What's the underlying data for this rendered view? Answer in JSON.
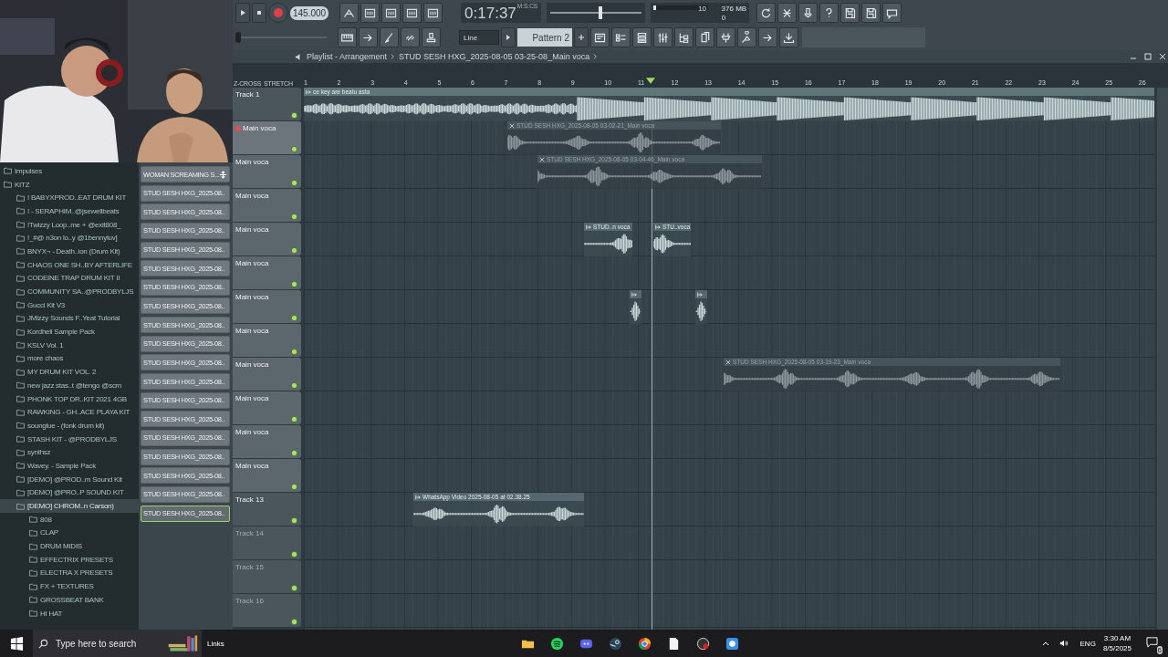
{
  "transport": {
    "recording": true,
    "tempo": "145.000",
    "time": "0:17:37",
    "time_format": "M:S:CS"
  },
  "master_volume": {
    "level": 0.55
  },
  "performance": {
    "cpu_reading": "10",
    "memory_reading": "376 MB",
    "voices_reading": "0",
    "level": 0.05
  },
  "position_slider": {
    "level": 0
  },
  "snap": "Line",
  "pattern": "Pattern 2",
  "browser": {
    "items": [
      {
        "name": "Impulses",
        "selected": false
      },
      {
        "name": "KITZ",
        "selected": false,
        "children": [
          {
            "name": "! BABYXPROD..EAT DRUM KIT",
            "selected": false
          },
          {
            "name": "! - SERAPHIM..@jsewellbeats",
            "selected": false
          },
          {
            "name": "!Twizzy Loop..me + @exit808_",
            "selected": false
          },
          {
            "name": "!_#@ n3on lo..y @1bennyluv]",
            "selected": false
          },
          {
            "name": "BNYX¬ - Death..ion (Drum Kit)",
            "selected": false
          },
          {
            "name": "CHAOS ONE SH..BY AFTERLIFE",
            "selected": false
          },
          {
            "name": "CODEINE TRAP DRUM KIT II",
            "selected": false
          },
          {
            "name": "COMMUNITY SA..@PRODBYLJS",
            "selected": false
          },
          {
            "name": "Gucci Kit V3",
            "selected": false
          },
          {
            "name": "JMizzy Sounds F..Yeat Tutorial",
            "selected": false
          },
          {
            "name": "Kordhell Sample Pack",
            "selected": false
          },
          {
            "name": "KSLV Vol. 1",
            "selected": false
          },
          {
            "name": "more chaos",
            "selected": false
          },
          {
            "name": "MY DRUM KIT VOL. 2",
            "selected": false
          },
          {
            "name": "new jazz stas..t @tengo @scrn",
            "selected": false
          },
          {
            "name": "PHONK TOP DR..KIT 2021 4GB",
            "selected": false
          },
          {
            "name": "RAWKING - GH..ACE PLAYA KIT",
            "selected": false
          },
          {
            "name": "sounglue - (fonk drum kit)",
            "selected": false
          },
          {
            "name": "STASH KIT - @PRODBYLJS",
            "selected": false
          },
          {
            "name": "synthsz",
            "selected": false
          },
          {
            "name": "Wavey. - Sample Pack",
            "selected": false
          },
          {
            "name": "[DEMO] @PROD..m Sound Kit",
            "selected": false
          },
          {
            "name": "[DEMO] @PRO..P SOUND KIT",
            "selected": false
          },
          {
            "name": "[DEMO] CHROM..n Carson)",
            "selected": true,
            "children": [
              {
                "name": "808",
                "selected": false
              },
              {
                "name": "CLAP",
                "selected": false
              },
              {
                "name": "DRUM MIDIS",
                "selected": false
              },
              {
                "name": "EFFECTRIX PRESETS",
                "selected": false
              },
              {
                "name": "ELECTRA X PRESETS",
                "selected": false
              },
              {
                "name": "FX + TEXTURES",
                "selected": false
              },
              {
                "name": "GROSSBEAT BANK",
                "selected": false
              },
              {
                "name": "HI HAT",
                "selected": false
              }
            ]
          }
        ]
      }
    ]
  },
  "patterns": [
    {
      "name": "WOMAN SCREAMING S...",
      "selected": false
    },
    {
      "name": "STUD SESH HXG_2025-08..",
      "selected": false
    },
    {
      "name": "STUD SESH HXG_2025-08..",
      "selected": false
    },
    {
      "name": "STUD SESH HXG_2025-08..",
      "selected": false
    },
    {
      "name": "STUD SESH HXG_2025-08..",
      "selected": false
    },
    {
      "name": "STUD SESH HXG_2025-08..",
      "selected": false
    },
    {
      "name": "STUD SESH HXG_2025-08..",
      "selected": false
    },
    {
      "name": "STUD SESH HXG_2025-08..",
      "selected": false
    },
    {
      "name": "STUD SESH HXG_2025-08..",
      "selected": false
    },
    {
      "name": "STUD SESH HXG_2025-08..",
      "selected": false
    },
    {
      "name": "STUD SESH HXG_2025-08..",
      "selected": false
    },
    {
      "name": "STUD SESH HXG_2025-08..",
      "selected": false
    },
    {
      "name": "STUD SESH HXG_2025-08..",
      "selected": false
    },
    {
      "name": "STUD SESH HXG_2025-08..",
      "selected": false
    },
    {
      "name": "STUD SESH HXG_2025-08..",
      "selected": false
    },
    {
      "name": "STUD SESH HXG_2025-08..",
      "selected": false
    },
    {
      "name": "STUD SESH HXG_2025-08..",
      "selected": false
    },
    {
      "name": "STUD SESH HXG_2025-08..",
      "selected": false
    },
    {
      "name": "STUD SESH HXG_2025-08..",
      "selected": true
    }
  ],
  "playlist": {
    "title": "Playlist - Arrangement",
    "breadcrumb": "STUD SESH HXG_2025-08-05 03-25-08_Main voca",
    "options": [
      "Z-CROSS",
      "STRETCH"
    ],
    "ruler": [
      "1",
      "2",
      "3",
      "4",
      "5",
      "6",
      "7",
      "8",
      "9",
      "10",
      "11",
      "12",
      "13",
      "14",
      "15",
      "16",
      "17",
      "18",
      "19",
      "20",
      "21",
      "22",
      "23",
      "24",
      "25",
      "26"
    ],
    "tracks": [
      {
        "name": "Track 1",
        "color": "#4b555c",
        "selected": false,
        "armed": false,
        "empty": false,
        "clips": [
          {
            "name": "ce key are beatu asta",
            "muted": false
          }
        ]
      },
      {
        "name": "Main voca",
        "color": "#5c666d",
        "selected": true,
        "armed": true,
        "empty": false,
        "clips": [
          {
            "name": "STUD SESH HXG_2025-08-05 03-02-21_Main voca",
            "muted": true
          }
        ]
      },
      {
        "name": "Main voca",
        "color": "#5c666d",
        "selected": false,
        "armed": false,
        "empty": false,
        "clips": [
          {
            "name": "STUD SESH HXG_2025-08-05 03-04-46_Main voca",
            "muted": true
          }
        ]
      },
      {
        "name": "Main voca",
        "color": "#5c666d",
        "selected": false,
        "armed": false,
        "empty": false
      },
      {
        "name": "Main voca",
        "color": "#5c666d",
        "selected": false,
        "armed": false,
        "empty": false,
        "clips": [
          {
            "name": "STUD..n voca",
            "muted": false
          },
          {
            "name": "STU..voca",
            "muted": false
          }
        ]
      },
      {
        "name": "Main voca",
        "color": "#5c666d",
        "selected": false,
        "armed": false,
        "empty": false
      },
      {
        "name": "Main voca",
        "color": "#5c666d",
        "selected": false,
        "armed": false,
        "empty": false,
        "clips": [
          {
            "muted": false
          },
          {
            "muted": false
          }
        ]
      },
      {
        "name": "Main voca",
        "color": "#5c666d",
        "selected": false,
        "armed": false,
        "empty": false
      },
      {
        "name": "Main voca",
        "color": "#5c666d",
        "selected": false,
        "armed": false,
        "empty": false,
        "clips": [
          {
            "name": "STUD SESH HXG_2025-08-05 03-19-23_Main voca",
            "muted": true
          }
        ]
      },
      {
        "name": "Main voca",
        "color": "#5c666d",
        "selected": false,
        "armed": false,
        "empty": false
      },
      {
        "name": "Main voca",
        "color": "#5c666d",
        "selected": false,
        "armed": false,
        "empty": false
      },
      {
        "name": "Main voca",
        "color": "#5c666d",
        "selected": false,
        "armed": false,
        "empty": false
      },
      {
        "name": "Track 13",
        "color": "#4b555c",
        "selected": false,
        "armed": false,
        "empty": false,
        "clips": [
          {
            "name": "WhatsApp Video 2025-08-05 at 02.38.25",
            "muted": false
          }
        ]
      },
      {
        "name": "Track 14",
        "color": "#4b555c",
        "selected": false,
        "armed": false,
        "empty": true
      },
      {
        "name": "Track 15",
        "color": "#4b555c",
        "selected": false,
        "armed": false,
        "empty": true
      },
      {
        "name": "Track 16",
        "color": "#4b555c",
        "selected": false,
        "armed": false,
        "empty": true
      }
    ]
  },
  "taskbar": {
    "search": {
      "placeholder": "Type here to search"
    },
    "links": "Links",
    "language": "ENG",
    "time": "3:30 AM",
    "date": "8/5/2025",
    "notification_count": "6"
  }
}
